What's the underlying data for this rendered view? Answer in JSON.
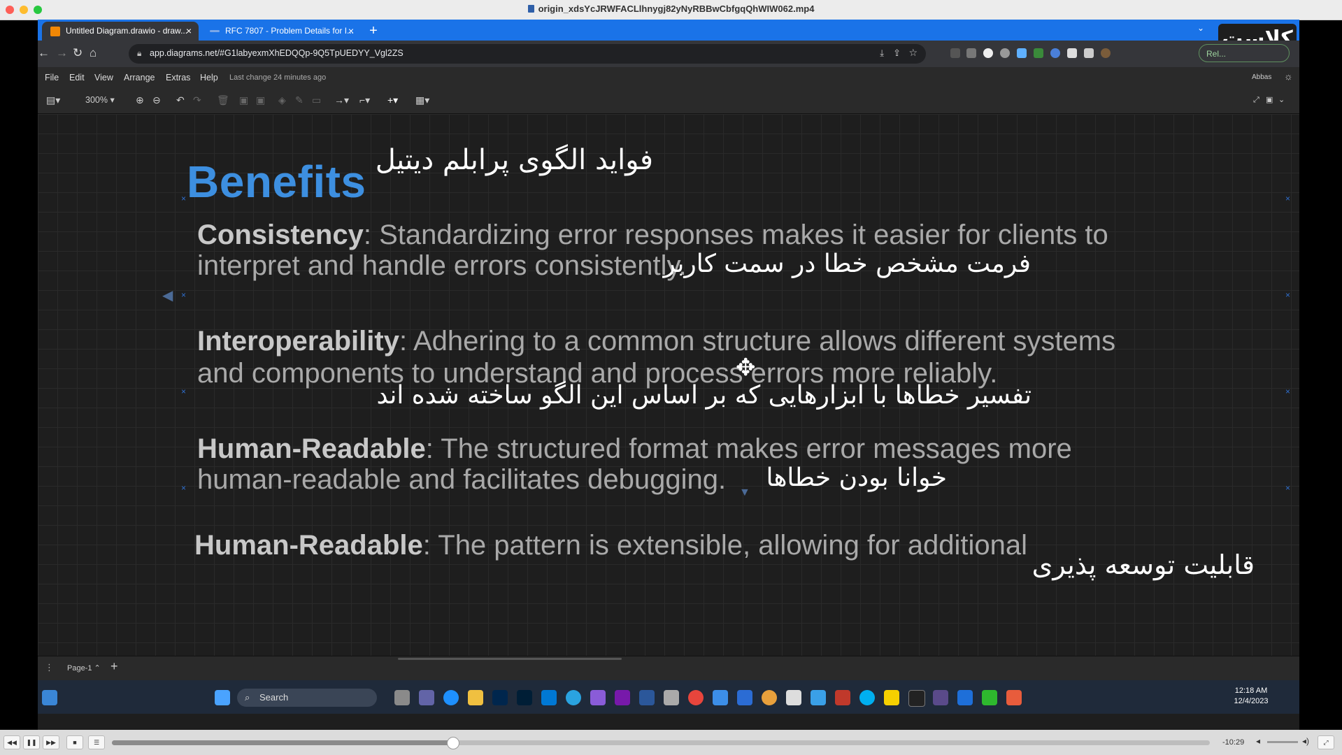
{
  "window": {
    "title": "origin_xdsYcJRWFACLlhnygj82yNyRBBwCbfgqQhWIW062.mp4"
  },
  "browser": {
    "tabs": [
      {
        "label": "Untitled Diagram.drawio - draw...",
        "active": true
      },
      {
        "label": "RFC 7807 - Problem Details for I...",
        "active": false
      }
    ],
    "url": "app.diagrams.net/#G1labyexmXhEDQQp-9Q5TpUEDYY_Vgl2ZS",
    "relaunch_label": "Rel...",
    "brand_overlay": "کلاست"
  },
  "drawio": {
    "menu": [
      "File",
      "Edit",
      "View",
      "Arrange",
      "Extras",
      "Help"
    ],
    "last_change": "Last change 24 minutes ago",
    "user": "Abbas",
    "zoom": "300%",
    "page_tab": "Page-1"
  },
  "slide": {
    "title": "Benefits",
    "title_fa": "فواید الگوی پرابلم دیتیل",
    "items": [
      {
        "term": "Consistency",
        "line1": ": Standardizing error responses makes it easier for clients to",
        "line2": "interpret and handle errors consistently.",
        "note_fa": "فرمت مشخص خطا در سمت کاربر"
      },
      {
        "term": "Interoperability",
        "line1": ": Adhering to a common structure allows different systems",
        "line2": "and components to understand and process errors more reliably.",
        "note_fa": "تفسیر خطاها با ابزارهایی که بر اساس این الگو ساخته شده اند"
      },
      {
        "term": "Human-Readable",
        "line1": ": The structured format makes error messages more",
        "line2": "human-readable and facilitates debugging.",
        "note_fa": "خوانا بودن خطاها"
      },
      {
        "term": "Human-Readable",
        "line1": ": The pattern is extensible, allowing for additional",
        "note_fa": "قابلیت توسعه پذیری"
      }
    ]
  },
  "taskbar": {
    "search_placeholder": "Search",
    "time": "12:18 AM",
    "date": "12/4/2023"
  },
  "player": {
    "remaining": "-10:29",
    "progress": 0.31
  }
}
